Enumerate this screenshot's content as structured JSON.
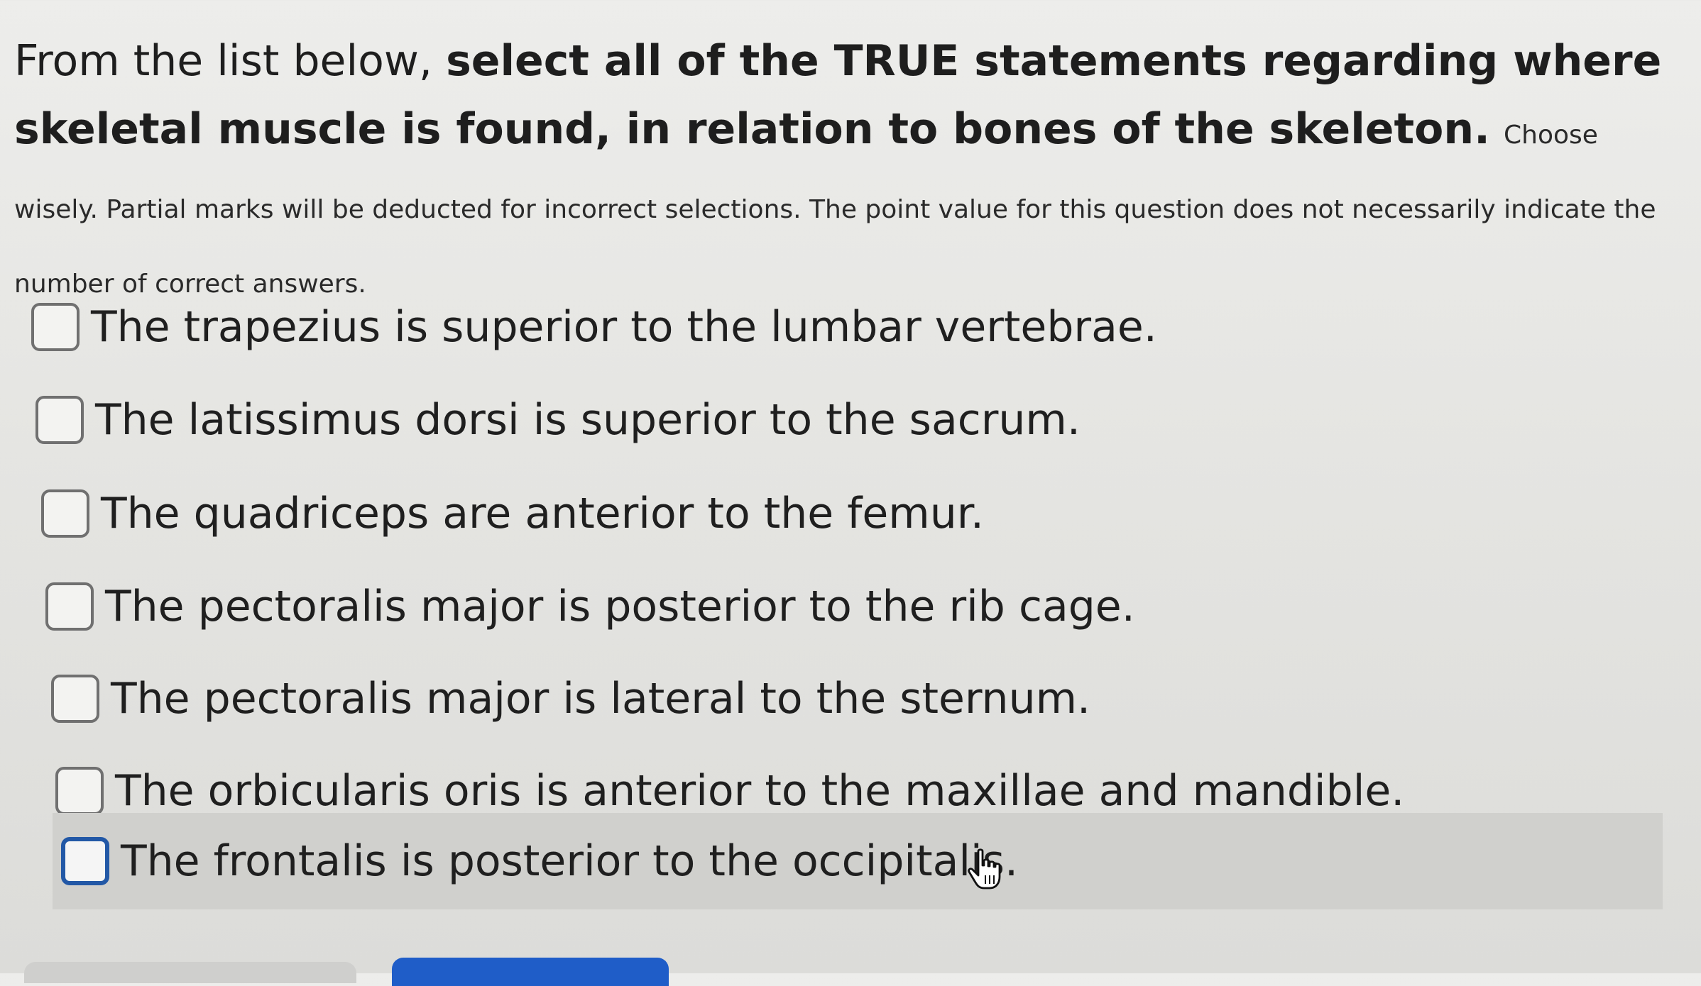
{
  "question": {
    "lead": "From the list below,",
    "bold": "select all of the TRUE statements regarding where skeletal muscle is found, in relation to bones of the skeleton.",
    "note": "Choose wisely. Partial marks will be deducted for incorrect selections. The point value for this question does not necessarily indicate the number of correct answers."
  },
  "options": [
    {
      "label": "The trapezius is superior to the lumbar vertebrae.",
      "checked": false
    },
    {
      "label": "The latissimus dorsi is superior to the sacrum.",
      "checked": false
    },
    {
      "label": "The quadriceps are anterior to the femur.",
      "checked": false
    },
    {
      "label": "The pectoralis major is posterior to the rib cage.",
      "checked": false
    },
    {
      "label": "The pectoralis major is lateral to the sternum.",
      "checked": false
    },
    {
      "label": "The orbicularis oris is anterior to the maxillae and mandible.",
      "checked": false
    },
    {
      "label": "The frontalis is posterior to the occipitalis.",
      "checked": false,
      "hovered": true
    }
  ],
  "colors": {
    "hover_background": "#d0d0cd",
    "focus_border": "#2258a6",
    "primary_button": "#1f5dc8"
  },
  "icons": {
    "cursor": "hand-pointer-icon"
  }
}
